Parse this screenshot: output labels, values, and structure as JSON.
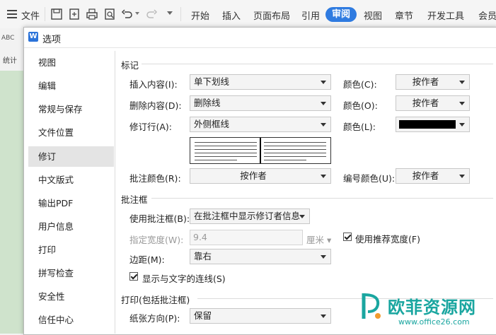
{
  "ribbon": {
    "menu_label": "文件",
    "tabs": [
      "开始",
      "插入",
      "页面布局",
      "引用",
      "审阅",
      "视图",
      "章节",
      "开发工具",
      "会员"
    ],
    "active_tab": "审阅"
  },
  "background": {
    "side_label": "统计",
    "side_icon_text": "ABC"
  },
  "dialog": {
    "logo": "W",
    "title": "选项",
    "nav": [
      "视图",
      "编辑",
      "常规与保存",
      "文件位置",
      "修订",
      "中文版式",
      "输出PDF",
      "用户信息",
      "打印",
      "拼写检查",
      "安全性",
      "信任中心"
    ],
    "active_nav": "修订",
    "markup": {
      "section_title": "标记",
      "insert_label": "插入内容(I):",
      "insert_value": "单下划线",
      "insert_color_label": "颜色(C):",
      "insert_color_value": "按作者",
      "delete_label": "删除内容(D):",
      "delete_value": "删除线",
      "delete_color_label": "颜色(O):",
      "delete_color_value": "按作者",
      "revline_label": "修订行(A):",
      "revline_value": "外侧框线",
      "revline_color_label": "颜色(L):",
      "revline_color_value": "#000000",
      "comment_color_label": "批注颜色(R):",
      "comment_color_value": "按作者",
      "number_color_label": "编号颜色(U):",
      "number_color_value": "按作者"
    },
    "balloons": {
      "section_title": "批注框",
      "use_label": "使用批注框(B):",
      "use_value": "在批注框中显示修订者信息",
      "width_label": "指定宽度(W):",
      "width_value": "9.4",
      "width_unit": "厘米",
      "recommend_label": "使用推荐宽度(F)",
      "recommend_checked": true,
      "margin_label": "边距(M):",
      "margin_value": "靠右",
      "lines_label": "显示与文字的连线(S)",
      "lines_checked": true
    },
    "printing": {
      "section_title": "打印(包括批注框)",
      "orientation_label": "纸张方向(P):",
      "orientation_value": "保留"
    }
  },
  "watermark": {
    "text": "欧菲资源网",
    "url": "www.office26.com"
  },
  "colors": {
    "accent": "#2f7be0",
    "watermark": "#1aa6a0"
  }
}
